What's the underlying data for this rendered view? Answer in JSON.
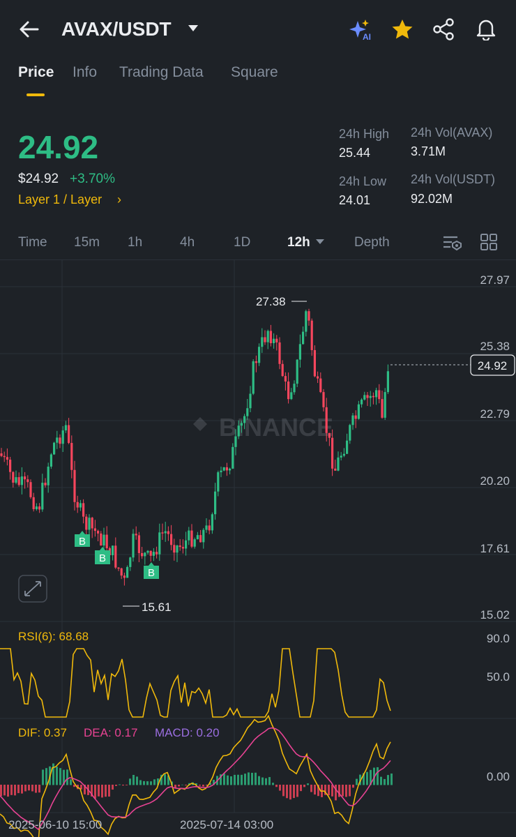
{
  "header": {
    "title": "AVAX/USDT",
    "icons": [
      "back-arrow-icon",
      "ai-sparkle-icon",
      "star-icon",
      "share-icon",
      "bell-icon"
    ]
  },
  "tabs": [
    "Price",
    "Info",
    "Trading Data",
    "Square"
  ],
  "price": {
    "last": "24.92",
    "usd": "$24.92",
    "change": "+3.70%",
    "tag": "Layer 1 / Layer",
    "tag_chevron": "›"
  },
  "stats": {
    "high_label": "24h High",
    "high_value": "25.44",
    "low_label": "24h Low",
    "low_value": "24.01",
    "vol_base_label": "24h Vol(AVAX)",
    "vol_base_value": "3.71M",
    "vol_quote_label": "24h Vol(USDT)",
    "vol_quote_value": "92.02M"
  },
  "intervals": [
    "Time",
    "15m",
    "1h",
    "4h",
    "1D",
    "12h",
    "Depth"
  ],
  "chart": {
    "y_ticks": [
      "27.97",
      "25.38",
      "22.79",
      "20.20",
      "17.61",
      "15.02"
    ],
    "high_label": "27.38",
    "low_label": "15.61",
    "last_price_label": "24.92",
    "buy_marker": "B",
    "watermark": "BINANCE",
    "rsi_label": "RSI(6): 68.68",
    "rsi_ticks": [
      "90.0",
      "50.0"
    ],
    "dif_label": "DIF: 0.37",
    "dea_label": "DEA: 0.17",
    "macd_label": "MACD: 0.20",
    "macd_tick": "0.00",
    "x_labels": [
      "2025-06-10 15:00",
      "2025-07-14 03:00"
    ],
    "colors": {
      "up": "#2ebd85",
      "down": "#f6465d",
      "rsi": "#f0b90b",
      "dea": "#e84393",
      "macd": "#9b6ee0",
      "accent": "#f0b90b"
    }
  }
}
